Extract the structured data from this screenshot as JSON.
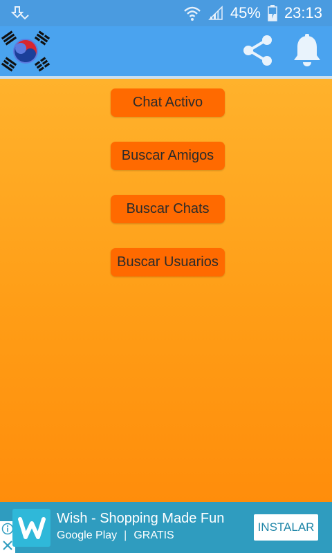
{
  "status_bar": {
    "battery": "45%",
    "time": "23:13"
  },
  "app_bar": {
    "share_icon": "share-icon",
    "notification_icon": "bell-icon"
  },
  "menu": {
    "buttons": [
      {
        "label": "Chat Activo"
      },
      {
        "label": "Buscar Amigos"
      },
      {
        "label": "Buscar Chats"
      },
      {
        "label": "Buscar Usuarios"
      }
    ]
  },
  "ad": {
    "title": "Wish - Shopping Made Fun",
    "store": "Google Play",
    "separator": "|",
    "price": "GRATIS",
    "install_label": "INSTALAR"
  },
  "colors": {
    "app_bar": "#4aa3ef",
    "status_bar": "#4a9be0",
    "button": "#ff6a00",
    "background_top": "#ffb22c",
    "background_bottom": "#ff8d0b",
    "ad_background": "#2f9cbf"
  }
}
